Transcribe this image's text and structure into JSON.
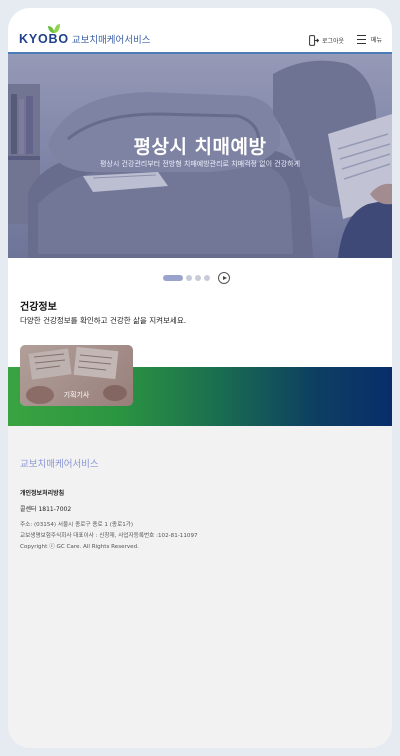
{
  "header": {
    "brand": "KYOBO",
    "service_name": "교보치매케어서비스",
    "login_label": "로그아웃",
    "menu_label": "메뉴"
  },
  "hero": {
    "title": "평상시 치매예방",
    "subtitle": "평상시 건강관리부터 전방형 치매예방관리로 치매걱정 없이 건강하게"
  },
  "carousel": {
    "total_slides": 4,
    "active_slide": 1
  },
  "health": {
    "title": "건강정보",
    "description": "다양한 건강정보를 확인하고 건강한 삶을 지켜보세요.",
    "card_label": "기획기사"
  },
  "footer": {
    "title": "교보치매케어서비스",
    "privacy_link": "개인정보처리방침",
    "call_center": "콜센터 1811-7002",
    "address": "주소: (03154) 서울시 종로구 종로 1 (종로1가)",
    "company": "교보생명보험주식회사 대표이사 : 신창재, 사업자등록번호 :102-81-11097",
    "copyright": "Copyright ⓒ GC Care. All Rights Reserved."
  },
  "colors": {
    "brand_blue": "#1e3f8a",
    "header_line": "#4a7db8",
    "footer_title": "#8c96d6",
    "band_start": "#3aa341",
    "band_end": "#082e6a"
  },
  "icons": {
    "login": "logout-icon",
    "menu": "hamburger-icon",
    "play": "play-icon",
    "logo": "leaf-icon"
  }
}
